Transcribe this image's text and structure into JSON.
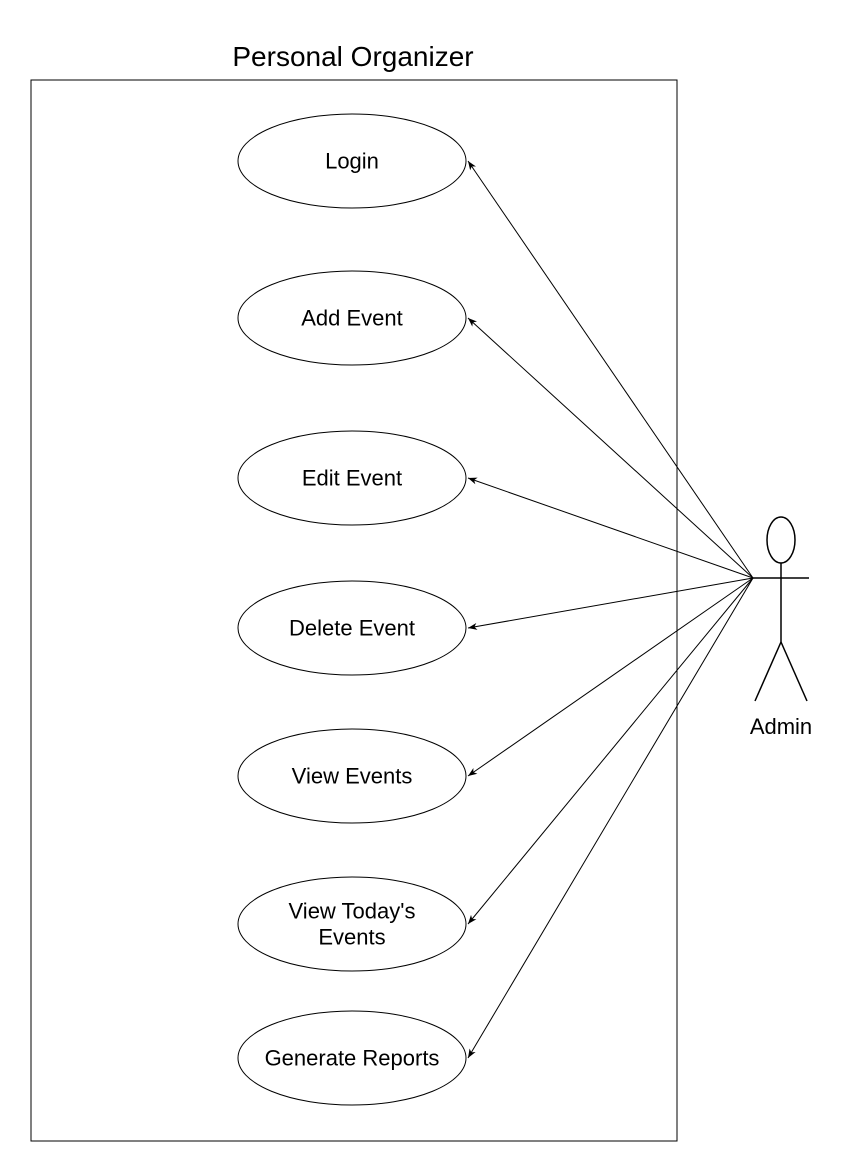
{
  "system": {
    "title": "Personal Organizer"
  },
  "actor": {
    "label": "Admin"
  },
  "use_cases": [
    {
      "lines": [
        "Login"
      ]
    },
    {
      "lines": [
        "Add Event"
      ]
    },
    {
      "lines": [
        "Edit Event"
      ]
    },
    {
      "lines": [
        "Delete Event"
      ]
    },
    {
      "lines": [
        "View Events"
      ]
    },
    {
      "lines": [
        "View Today's",
        "Events"
      ]
    },
    {
      "lines": [
        "Generate Reports"
      ]
    }
  ],
  "colors": {
    "stroke": "#000000",
    "fill": "#ffffff"
  }
}
